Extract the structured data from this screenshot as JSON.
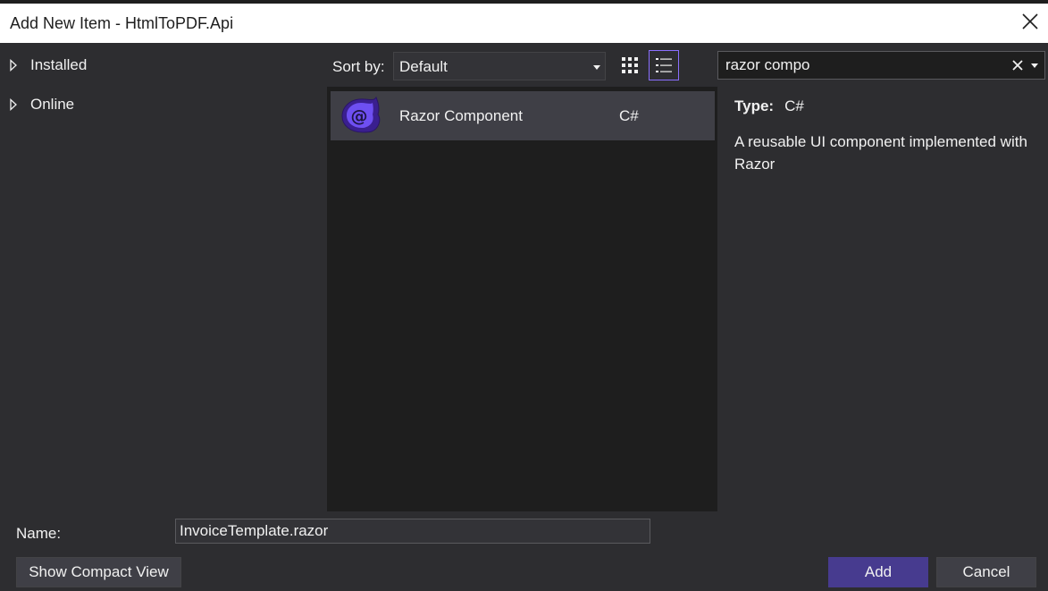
{
  "window": {
    "title": "Add New Item - HtmlToPDF.Api"
  },
  "tree": {
    "items": [
      {
        "label": "Installed"
      },
      {
        "label": "Online"
      }
    ]
  },
  "toolbar": {
    "sort_label": "Sort by:",
    "sort_value": "Default",
    "view_mode": "list"
  },
  "search": {
    "value": "razor compo"
  },
  "templates": [
    {
      "name": "Razor Component",
      "language": "C#",
      "icon": "razor-component-icon",
      "selected": true
    }
  ],
  "details": {
    "type_label": "Type:",
    "type_value": "C#",
    "description": "A reusable UI component implemented with Razor"
  },
  "footer": {
    "name_label": "Name:",
    "name_value": "InvoiceTemplate.razor",
    "compact_label": "Show Compact View",
    "add_label": "Add",
    "cancel_label": "Cancel"
  },
  "colors": {
    "accent": "#473b8f",
    "accent_border": "#8a6fff",
    "background": "#2d2d30",
    "list_background": "#1e1e1e",
    "selected_item": "#3f3f46"
  }
}
